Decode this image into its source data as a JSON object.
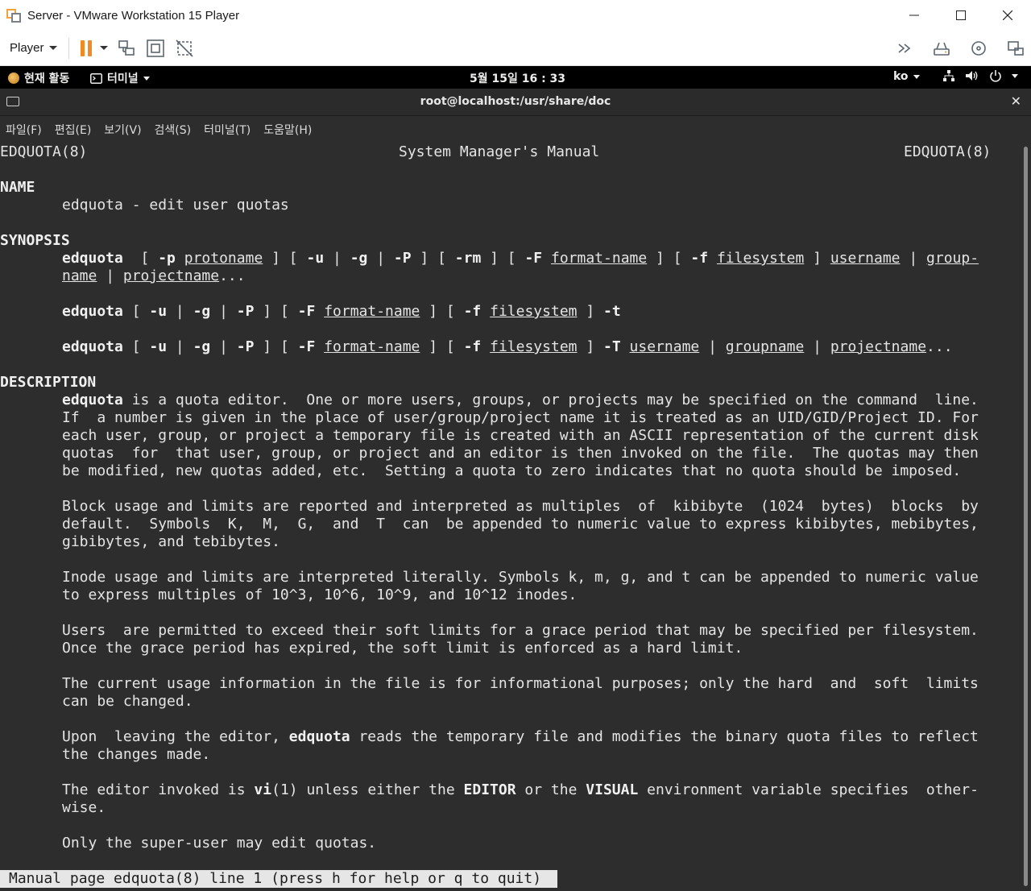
{
  "window": {
    "title": "Server - VMware Workstation 15 Player"
  },
  "toolbar": {
    "player_label": "Player"
  },
  "gnome": {
    "activities": "현재 활동",
    "terminal_app": "터미널",
    "clock": "5월 15일  16 : 33",
    "lang": "ko"
  },
  "terminal": {
    "title": "root@localhost:/usr/share/doc",
    "menu": [
      "파일(F)",
      "편집(E)",
      "보기(V)",
      "검색(S)",
      "터미널(T)",
      "도움말(H)"
    ]
  },
  "man": {
    "header_left": "EDQUOTA(8)",
    "header_center": "System Manager's Manual",
    "header_right": "EDQUOTA(8)",
    "sec_name": "NAME",
    "name_line": "edquota - edit user quotas",
    "sec_synopsis": "SYNOPSIS",
    "syn": {
      "cmd": "edquota",
      "p": "-p",
      "protoname": "protoname",
      "u": "-u",
      "g": "-g",
      "P": "-P",
      "rm": "-rm",
      "F": "-F",
      "format_name": "format-name",
      "f": "-f",
      "filesystem": "filesystem",
      "username": "username",
      "group_hyph": "group‐",
      "name": "name",
      "projectname": "projectname",
      "ellipsis": "...",
      "t": "-t",
      "T": "-T",
      "groupname": "groupname"
    },
    "sec_description": "DESCRIPTION",
    "d1": {
      "cmd": "edquota",
      "l1_rest": " is a quota editor.  One or more users, groups, or projects may be specified on the command  line.",
      "l2": "If  a number is given in the place of user/group/project name it is treated as an UID/GID/Project ID. For",
      "l3": "each user, group, or project a temporary file is created with an ASCII representation of the current disk",
      "l4": "quotas  for  that user, group, or project and an editor is then invoked on the file.  The quotas may then",
      "l5": "be modified, new quotas added, etc.  Setting a quota to zero indicates that no quota should be imposed."
    },
    "d2": {
      "l1": "Block usage and limits are reported and interpreted as multiples  of  kibibyte  (1024  bytes)  blocks  by",
      "l2": "default.  Symbols  K,  M,  G,  and  T  can  be appended to numeric value to express kibibytes, mebibytes,",
      "l3": "gibibytes, and tebibytes."
    },
    "d3": {
      "l1": "Inode usage and limits are interpreted literally. Symbols k, m, g, and t can be appended to numeric value",
      "l2": "to express multiples of 10^3, 10^6, 10^9, and 10^12 inodes."
    },
    "d4": {
      "l1": "Users  are permitted to exceed their soft limits for a grace period that may be specified per filesystem.",
      "l2": "Once the grace period has expired, the soft limit is enforced as a hard limit."
    },
    "d5": {
      "l1": "The current usage information in the file is for informational purposes; only the hard  and  soft  limits",
      "l2": "can be changed."
    },
    "d6": {
      "l1_pre": "Upon  leaving the editor, ",
      "cmd": "edquota",
      "l1_post": " reads the temporary file and modifies the binary quota files to reflect",
      "l2": "the changes made."
    },
    "d7": {
      "pre": "The editor invoked is ",
      "vi": "vi",
      "mid1": "(1) unless either the ",
      "editor": "EDITOR",
      "mid2": " or the ",
      "visual": "VISUAL",
      "post": " environment variable specifies  other‐",
      "l2": "wise."
    },
    "d8": "Only the super-user may edit quotas.",
    "status": "Manual page edquota(8) line 1 (press h for help or q to quit)"
  }
}
